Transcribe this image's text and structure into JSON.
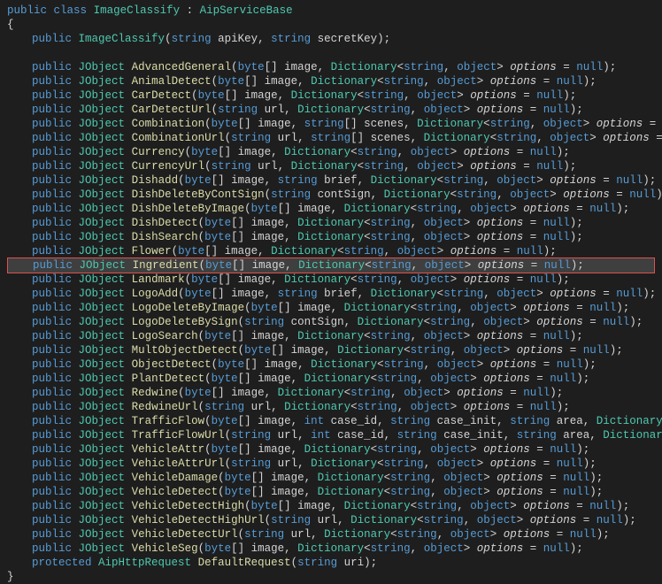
{
  "header": {
    "public": "public",
    "class": "class",
    "className": "ImageClassify",
    "colon": " : ",
    "base": "AipServiceBase"
  },
  "braceOpen": "{",
  "braceClose": "}",
  "ctor": {
    "pub": "public",
    "name": "ImageClassify",
    "sig_open": "(",
    "p1t": "string",
    "p1n": " apiKey, ",
    "p2t": "string",
    "p2n": " secretKey",
    "sig_close": ");"
  },
  "methods": [
    {
      "name": "AdvancedGeneral",
      "params": "byte[] image, Dictionary<string, object> options = null"
    },
    {
      "name": "AnimalDetect",
      "params": "byte[] image, Dictionary<string, object> options = null"
    },
    {
      "name": "CarDetect",
      "params": "byte[] image, Dictionary<string, object> options = null"
    },
    {
      "name": "CarDetectUrl",
      "params": "string url, Dictionary<string, object> options = null"
    },
    {
      "name": "Combination",
      "params": "byte[] image, string[] scenes, Dictionary<string, object> options = null"
    },
    {
      "name": "CombinationUrl",
      "params": "string url, string[] scenes, Dictionary<string, object> options = null"
    },
    {
      "name": "Currency",
      "params": "byte[] image, Dictionary<string, object> options = null"
    },
    {
      "name": "CurrencyUrl",
      "params": "string url, Dictionary<string, object> options = null"
    },
    {
      "name": "Dishadd",
      "params": "byte[] image, string brief, Dictionary<string, object> options = null"
    },
    {
      "name": "DishDeleteByContSign",
      "params": "string contSign, Dictionary<string, object> options = null"
    },
    {
      "name": "DishDeleteByImage",
      "params": "byte[] image, Dictionary<string, object> options = null"
    },
    {
      "name": "DishDetect",
      "params": "byte[] image, Dictionary<string, object> options = null"
    },
    {
      "name": "DishSearch",
      "params": "byte[] image, Dictionary<string, object> options = null"
    },
    {
      "name": "Flower",
      "params": "byte[] image, Dictionary<string, object> options = null"
    },
    {
      "name": "Ingredient",
      "params": "byte[] image, Dictionary<string, object> options = null",
      "highlight": true
    },
    {
      "name": "Landmark",
      "params": "byte[] image, Dictionary<string, object> options = null"
    },
    {
      "name": "LogoAdd",
      "params": "byte[] image, string brief, Dictionary<string, object> options = null"
    },
    {
      "name": "LogoDeleteByImage",
      "params": "byte[] image, Dictionary<string, object> options = null"
    },
    {
      "name": "LogoDeleteBySign",
      "params": "string contSign, Dictionary<string, object> options = null"
    },
    {
      "name": "LogoSearch",
      "params": "byte[] image, Dictionary<string, object> options = null"
    },
    {
      "name": "MultObjectDetect",
      "params": "byte[] image, Dictionary<string, object> options = null"
    },
    {
      "name": "ObjectDetect",
      "params": "byte[] image, Dictionary<string, object> options = null"
    },
    {
      "name": "PlantDetect",
      "params": "byte[] image, Dictionary<string, object> options = null"
    },
    {
      "name": "Redwine",
      "params": "byte[] image, Dictionary<string, object> options = null"
    },
    {
      "name": "RedwineUrl",
      "params": "string url, Dictionary<string, object> options = null"
    },
    {
      "name": "TrafficFlow",
      "params": "byte[] image, int case_id, string case_init, string area, Dictionary<string"
    },
    {
      "name": "TrafficFlowUrl",
      "params": "string url, int case_id, string case_init, string area, Dictionary<strin"
    },
    {
      "name": "VehicleAttr",
      "params": "byte[] image, Dictionary<string, object> options = null"
    },
    {
      "name": "VehicleAttrUrl",
      "params": "string url, Dictionary<string, object> options = null"
    },
    {
      "name": "VehicleDamage",
      "params": "byte[] image, Dictionary<string, object> options = null"
    },
    {
      "name": "VehicleDetect",
      "params": "byte[] image, Dictionary<string, object> options = null"
    },
    {
      "name": "VehicleDetectHigh",
      "params": "byte[] image, Dictionary<string, object> options = null"
    },
    {
      "name": "VehicleDetectHighUrl",
      "params": "string url, Dictionary<string, object> options = null"
    },
    {
      "name": "VehicleDetectUrl",
      "params": "string url, Dictionary<string, object> options = null"
    },
    {
      "name": "VehicleSeg",
      "params": "byte[] image, Dictionary<string, object> options = null"
    }
  ],
  "lastLine": {
    "mod": "protected",
    "ret": "AipHttpRequest",
    "name": "DefaultRequest",
    "paramT": "string",
    "paramN": " uri",
    "end": ");"
  },
  "tokens": {
    "pub": "public",
    "jobject": "JObject",
    "close": ");"
  }
}
